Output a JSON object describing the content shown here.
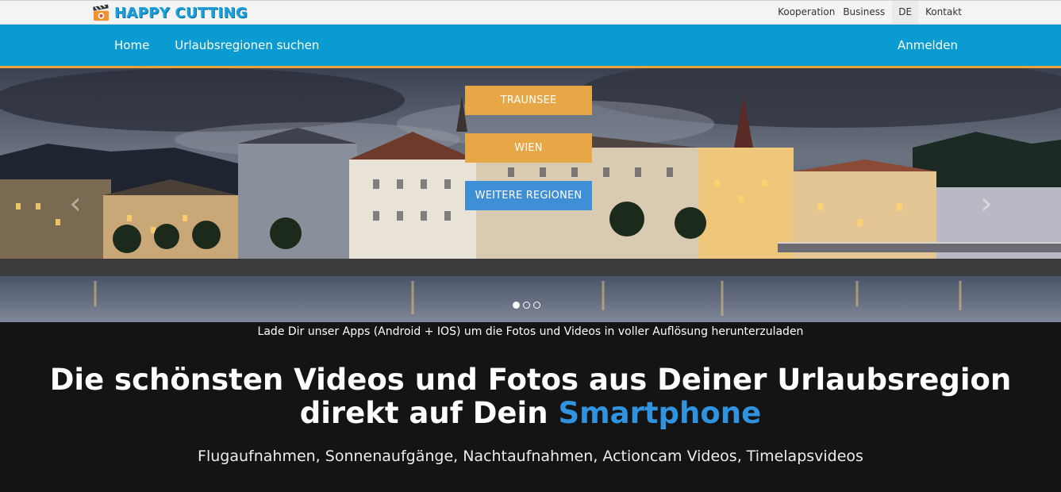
{
  "brand": {
    "name": "HAPPY CUTTING",
    "icon": "clapperboard-icon"
  },
  "utility_nav": {
    "kooperation": "Kooperation",
    "business": "Business",
    "language": "DE",
    "kontakt": "Kontakt"
  },
  "main_nav": {
    "home": "Home",
    "regions": "Urlaubsregionen suchen",
    "login": "Anmelden"
  },
  "hero": {
    "buttons": {
      "traunsee": "TRAUNSEE",
      "wien": "WIEN",
      "more": "WEITERE REGIONEN"
    },
    "prev_icon": "chevron-left-icon",
    "next_icon": "chevron-right-icon",
    "slides": 3,
    "active_slide": 1
  },
  "app_note": "Lade Dir unser Apps (Android + IOS) um die Fotos und Videos in voller Auflösung herunterzuladen",
  "headline": {
    "line1": "Die schönsten Videos und Fotos aus Deiner Urlaubsregion",
    "line2_prefix": "direkt auf Dein ",
    "line2_accent": "Smartphone"
  },
  "subline": "Flugaufnahmen, Sonnenaufgänge, Nachtaufnahmen, Actioncam Videos, Timelapsvideos",
  "colors": {
    "nav_blue": "#0a9bd1",
    "nav_border_orange": "#e8a33b",
    "button_orange": "#e8a747",
    "button_blue": "#3e8fd5",
    "accent_blue": "#2f93e0",
    "dark_bg": "#141414"
  }
}
